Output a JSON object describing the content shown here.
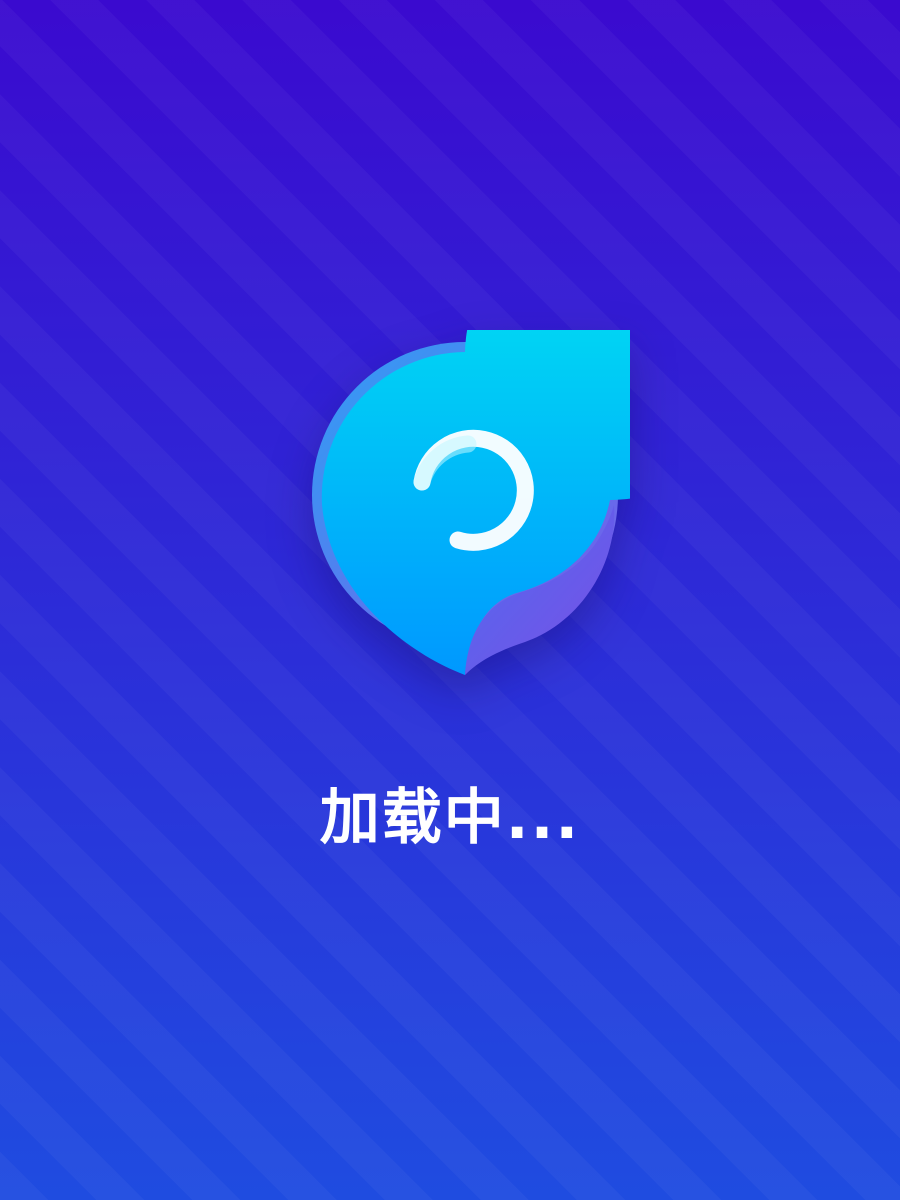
{
  "screen": {
    "type": "splash-loading",
    "background_top": "#3A0ACF",
    "background_bottom": "#1F4CE0",
    "stripe_color": "#FFFFFF"
  },
  "logo": {
    "icon": "chat-bubble-loading-spinner-icon",
    "bubble_top_color": "#00E8F0",
    "bubble_bottom_color": "#0098FF",
    "fold_color": "#6A4BE8",
    "spinner_color": "#FFFFFF"
  },
  "status": {
    "loading_text": "加载中..."
  }
}
